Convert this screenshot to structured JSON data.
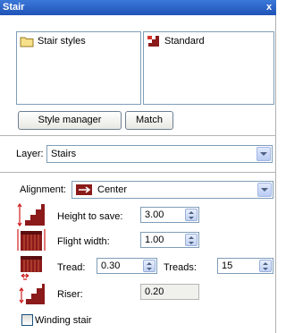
{
  "window": {
    "title": "Stair",
    "close_glyph": "x"
  },
  "styles_list": {
    "items": [
      {
        "label": "Stair styles",
        "icon": "folder-icon"
      }
    ]
  },
  "styles_detail": {
    "items": [
      {
        "label": "Standard",
        "icon": "stair-style-icon"
      }
    ]
  },
  "buttons": {
    "style_manager": "Style manager",
    "match": "Match"
  },
  "layer": {
    "label": "Layer:",
    "value": "Stairs"
  },
  "alignment": {
    "label": "Alignment:",
    "value": "Center"
  },
  "height_to_save": {
    "label": "Height to save:",
    "value": "3.00"
  },
  "flight_width": {
    "label": "Flight width:",
    "value": "1.00"
  },
  "tread": {
    "label": "Tread:",
    "value": "0.30"
  },
  "treads": {
    "label": "Treads:",
    "value": "15"
  },
  "riser": {
    "label": "Riser:",
    "value": "0.20"
  },
  "winding": {
    "label": "Winding stair",
    "checked": false
  },
  "colors": {
    "title_bar": "#2a5fc4",
    "icon_red": "#8b1a1a"
  }
}
